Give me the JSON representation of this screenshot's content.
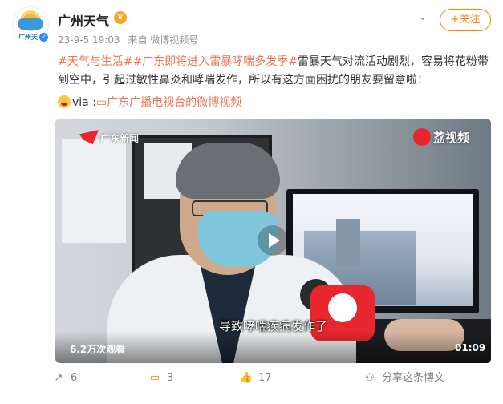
{
  "account": {
    "name": "广州天气",
    "avatar_text": "广州天气",
    "badge_icon": "vip-crown-icon",
    "verified_icon": "verified-check-icon"
  },
  "meta": {
    "timestamp": "23-9-5 19:03",
    "source": "来自 微博视频号"
  },
  "follow_button": {
    "label": "+关注"
  },
  "post": {
    "tag1": "#天气与生活#",
    "tag2": "#广东即将进入雷暴哮喘多发季#",
    "text": "雷暴天气对流活动剧烈，容易将花粉带到空中，引起过敏性鼻炎和哮喘发作，所以有这方面困扰的朋友要留意啦！",
    "via": "via :",
    "link_icon": "video-link-icon",
    "source_link": "广东广播电视台的微博视频"
  },
  "video": {
    "logo_left": "广东新闻",
    "logo_right": "荔视频",
    "subtitle": "导致哮喘疾病发作了",
    "views": "6.2万次观看",
    "duration": "01:09",
    "play_icon": "play-icon"
  },
  "actions": {
    "forward_count": "6",
    "comment_count": "3",
    "like_count": "17",
    "share_label": "分享这条博文"
  },
  "colors": {
    "accent": "#ff8200",
    "link": "#eb7350",
    "text": "#333333",
    "meta": "#939393"
  }
}
